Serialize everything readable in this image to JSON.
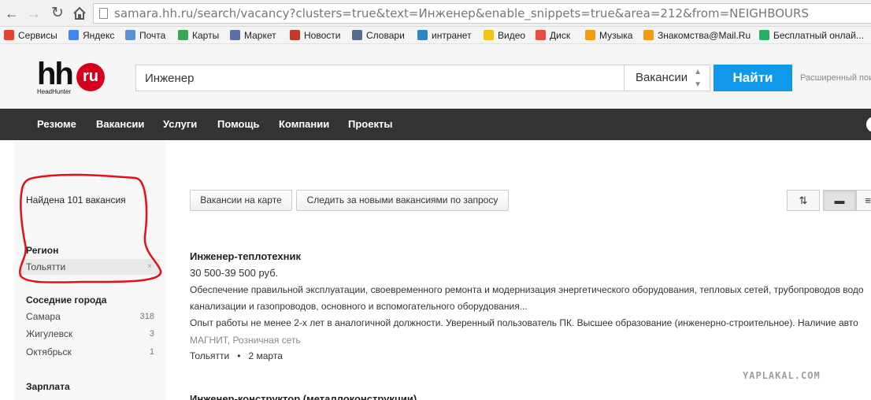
{
  "browser": {
    "url_scheme": "",
    "url_host": "samara.hh.ru",
    "url_path": "/search/vacancy?clusters=true&text=Инженер&enable_snippets=true&area=212&from=NEIGHBOURS"
  },
  "bookmarks": [
    {
      "label": "Сервисы",
      "color": "#e94235"
    },
    {
      "label": "Яндекс",
      "color": "#4285f4"
    },
    {
      "label": "Почта",
      "color": "#5b8fd6"
    },
    {
      "label": "Карты",
      "color": "#3aa757"
    },
    {
      "label": "Маркет",
      "color": "#5b6fa8"
    },
    {
      "label": "Новости",
      "color": "#c0392b"
    },
    {
      "label": "Словари",
      "color": "#556b8c"
    },
    {
      "label": "интранет",
      "color": "#2e86c1"
    },
    {
      "label": "Видео",
      "color": "#f1c40f"
    },
    {
      "label": "Диск",
      "color": "#e74c3c"
    },
    {
      "label": "Музыка",
      "color": "#f39c12"
    },
    {
      "label": "Знакомства@Mail.Ru",
      "color": "#f39c12"
    },
    {
      "label": "Бесплатный онлай...",
      "color": "#27ae60"
    }
  ],
  "header": {
    "logo_text": "hh",
    "logo_badge": "ru",
    "logo_sub": "HeadHunter",
    "search_value": "Инженер",
    "search_type": "Вакансии",
    "find_label": "Найти",
    "advanced_link": "Расширенный поиск"
  },
  "menu": [
    "Резюме",
    "Вакансии",
    "Услуги",
    "Помощь",
    "Компании",
    "Проекты"
  ],
  "sidebar": {
    "found": "Найдена 101 вакансия",
    "region_title": "Регион",
    "region_selected": "Тольятти",
    "neighbors_title": "Соседние города",
    "neighbors": [
      {
        "name": "Самара",
        "count": "318"
      },
      {
        "name": "Жигулевск",
        "count": "3"
      },
      {
        "name": "Октябрьск",
        "count": "1"
      }
    ],
    "salary_title": "Зарплата"
  },
  "toolbar": {
    "map_button": "Вакансии на карте",
    "subscribe_button": "Следить за новыми вакансиями по запросу"
  },
  "vacancy": {
    "title": "Инженер-теплотехник",
    "salary": "30 500-39 500 руб.",
    "desc1": "Обеспечение правильной эксплуатации, своевременного ремонта и модернизация энергетического оборудования, тепловых сетей, трубопроводов водо",
    "desc2": "канализации и газопроводов, основного и вспомогательного оборудования...",
    "desc3": "Опыт работы не менее 2-х лет в аналогичной должности. Уверенный пользователь ПК. Высшее образование (инженерно-строительное). Наличие авто",
    "company": "МАГНИТ, Розничная сеть",
    "city": "Тольятти",
    "date": "2 марта"
  },
  "next_vacancy_title": "Инженер-конструктор (металлоконструкции)",
  "watermark": "YAPLAKAL.COM",
  "colors": {
    "find_button": "#0f99e8",
    "menu_bg": "#333333",
    "logo_red": "#d6001c",
    "annotation_red": "#e0101c"
  }
}
